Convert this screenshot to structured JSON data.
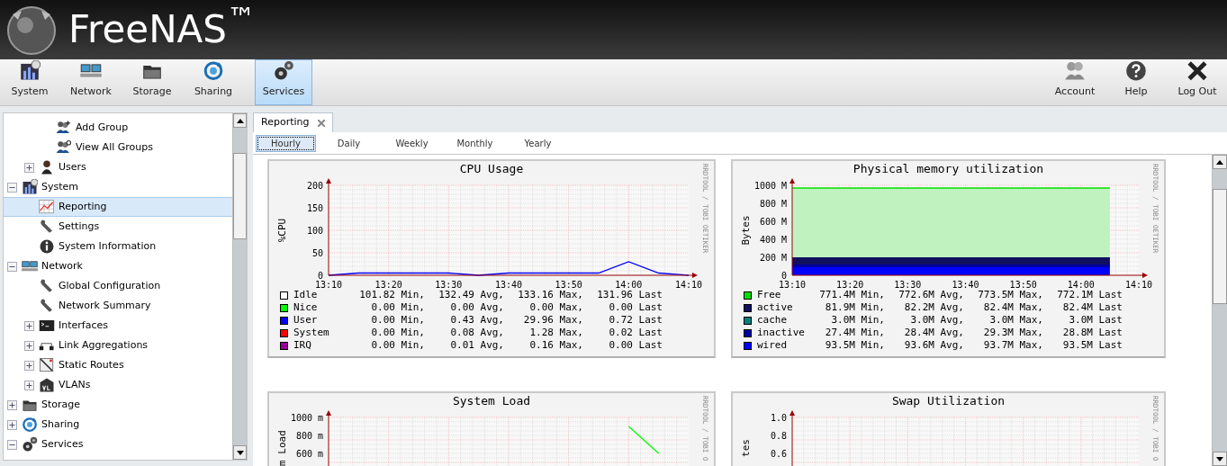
{
  "header": {
    "logo": "FreeNAS$^{™}$"
  },
  "toolbar": {
    "left": [
      {
        "label": "System",
        "kind": "system",
        "selected": false
      },
      {
        "label": "Network",
        "kind": "network",
        "selected": false
      },
      {
        "label": "Storage",
        "kind": "storage",
        "selected": false
      },
      {
        "label": "Sharing",
        "kind": "sharing",
        "selected": false
      },
      {
        "label": "Services",
        "kind": "services",
        "selected": true
      }
    ],
    "right": [
      {
        "label": "Account",
        "kind": "account"
      },
      {
        "label": "Help",
        "kind": "help"
      },
      {
        "label": "Log Out",
        "kind": "logout"
      }
    ]
  },
  "tree": [
    {
      "children": [
        {
          "children": [
            {
              "label": "Add Group",
              "kind": "groupadd",
              "selected": false
            },
            {
              "label": "View All Groups",
              "kind": "groups",
              "selected": false
            }
          ]
        },
        {
          "label": "Users",
          "kind": "user",
          "expanded": false,
          "selected": false
        }
      ]
    },
    {
      "label": "System",
      "kind": "system",
      "expanded": true,
      "selected": false,
      "children": [
        {
          "label": "Reporting",
          "kind": "chart",
          "selected": true
        },
        {
          "label": "Settings",
          "kind": "wrench",
          "selected": false
        },
        {
          "label": "System Information",
          "kind": "info",
          "selected": false
        }
      ]
    },
    {
      "label": "Network",
      "kind": "network",
      "expanded": true,
      "selected": false,
      "children": [
        {
          "label": "Global Configuration",
          "kind": "wrench",
          "selected": false
        },
        {
          "label": "Network Summary",
          "kind": "wrench",
          "selected": false
        },
        {
          "label": "Interfaces",
          "kind": "terminal",
          "expanded": false,
          "selected": false
        },
        {
          "label": "Link Aggregations",
          "kind": "link",
          "expanded": false,
          "selected": false
        },
        {
          "label": "Static Routes",
          "kind": "route",
          "expanded": false,
          "selected": false
        },
        {
          "label": "VLANs",
          "kind": "vlan",
          "expanded": false,
          "selected": false
        }
      ]
    },
    {
      "label": "Storage",
      "kind": "storage",
      "expanded": false,
      "selected": false
    },
    {
      "label": "Sharing",
      "kind": "sharing",
      "expanded": false,
      "selected": false
    },
    {
      "label": "Services",
      "kind": "services",
      "expanded": true,
      "selected": false
    }
  ],
  "tab": {
    "label": "Reporting"
  },
  "periods": [
    {
      "label": "Hourly",
      "selected": true
    },
    {
      "label": "Daily",
      "selected": false
    },
    {
      "label": "Weekly",
      "selected": false
    },
    {
      "label": "Monthly",
      "selected": false
    },
    {
      "label": "Yearly",
      "selected": false
    }
  ],
  "charts": [
    {
      "credit": "RRDTOOL / TOBI OETIKER",
      "chart_data": {
        "type": "line",
        "grid": true,
        "title": "CPU Usage",
        "ylabel": "%CPU",
        "categories": [
          "13:10",
          null,
          "13:20",
          null,
          "13:30",
          null,
          "13:40",
          null,
          "13:50",
          null,
          "14:00",
          null,
          "14:10"
        ],
        "ylim": [
          0,
          200
        ],
        "yticks": [
          0,
          50,
          100,
          150,
          200
        ],
        "series": [
          {
            "name": "Idle",
            "color": "#ffffff",
            "values": [
              null,
              null,
              null,
              null,
              null,
              null,
              null,
              null,
              null,
              null,
              null,
              null,
              null
            ]
          },
          {
            "name": "Nice",
            "color": "#00ff00",
            "values": [
              null,
              null,
              null,
              null,
              null,
              null,
              null,
              null,
              null,
              null,
              null,
              null,
              null
            ]
          },
          {
            "name": "User",
            "color": "#0000ff",
            "values": [
              0,
              5,
              5,
              5,
              5,
              0,
              5,
              5,
              5,
              5,
              30,
              5,
              0
            ]
          },
          {
            "name": "System",
            "color": "#ff0000",
            "values": [
              null,
              null,
              null,
              null,
              null,
              null,
              null,
              null,
              null,
              null,
              null,
              null,
              null
            ]
          },
          {
            "name": "IRQ",
            "color": "#990099",
            "values": [
              null,
              null,
              null,
              null,
              null,
              null,
              null,
              null,
              null,
              null,
              null,
              null,
              null
            ]
          }
        ]
      },
      "legend": [
        {
          "stats": [
            "101.82 Min,",
            "132.49 Avg,",
            "133.16 Max,",
            "131.96 Last"
          ]
        },
        {
          "stats": [
            "0.00 Min,",
            "0.00 Avg,",
            "0.00 Max,",
            "0.00 Last"
          ]
        },
        {
          "stats": [
            "0.00 Min,",
            "0.43 Avg,",
            "29.96 Max,",
            "0.72 Last"
          ]
        },
        {
          "stats": [
            "0.00 Min,",
            "0.08 Avg,",
            "1.28 Max,",
            "0.02 Last"
          ]
        },
        {
          "stats": [
            "0.00 Min,",
            "0.01 Avg,",
            "0.16 Max,",
            "0.00 Last"
          ]
        }
      ]
    },
    {
      "credit": "RRDTOOL / TOBI OETIKER",
      "chart_data": {
        "type": "area",
        "grid": true,
        "stacked": true,
        "title": "Physical memory utilization",
        "ylabel": "Bytes",
        "categories": [
          "13:10",
          null,
          "13:20",
          null,
          "13:30",
          null,
          "13:40",
          null,
          "13:50",
          null,
          "14:00",
          null,
          "14:10"
        ],
        "ylim": [
          0,
          1000
        ],
        "yticks": [
          {
            "value": 0,
            "label": "0"
          },
          {
            "value": 200,
            "label": "200 M"
          },
          {
            "value": 400,
            "label": "400 M"
          },
          {
            "value": 600,
            "label": "600 M"
          },
          {
            "value": 800,
            "label": "800 M"
          },
          {
            "value": 1000,
            "label": "1000 M"
          }
        ],
        "series": [
          {
            "name": "Free",
            "color": "#00e000",
            "values": [
              770,
              770,
              770,
              770,
              770,
              770,
              770,
              770,
              770,
              770,
              770,
              770,
              null
            ]
          },
          {
            "name": "active",
            "color": "#101060",
            "values": [
              80,
              80,
              80,
              80,
              80,
              80,
              80,
              80,
              80,
              80,
              80,
              80,
              null
            ]
          },
          {
            "name": "cache",
            "color": "#008080",
            "values": [
              null,
              null,
              null,
              null,
              null,
              null,
              null,
              null,
              null,
              null,
              null,
              null,
              null
            ]
          },
          {
            "name": "inactive",
            "color": "#0000a0",
            "values": [
              30,
              30,
              30,
              30,
              30,
              30,
              30,
              30,
              30,
              30,
              30,
              30,
              null
            ]
          },
          {
            "name": "wired",
            "color": "#0000ff",
            "values": [
              90,
              90,
              90,
              90,
              90,
              90,
              90,
              90,
              90,
              90,
              90,
              90,
              null
            ]
          }
        ]
      },
      "legend": [
        {
          "stats": [
            "771.4M Min,",
            "772.6M Avg,",
            "773.5M Max,",
            "772.1M Last"
          ]
        },
        {
          "stats": [
            "81.9M Min,",
            "82.2M Avg,",
            "82.4M Max,",
            "82.4M Last"
          ]
        },
        {
          "stats": [
            "3.0M Min,",
            "3.0M Avg,",
            "3.0M Max,",
            "3.0M Last"
          ]
        },
        {
          "stats": [
            "27.4M Min,",
            "28.4M Avg,",
            "29.3M Max,",
            "28.8M Last"
          ]
        },
        {
          "stats": [
            "93.5M Min,",
            "93.6M Avg,",
            "93.7M Max,",
            "93.5M Last"
          ]
        }
      ]
    },
    {
      "credit": "RRDTOOL / TOBI O",
      "chart_data": {
        "type": "line",
        "grid": true,
        "title": "System Load",
        "ylabel": "m Load",
        "categories": [
          null,
          null,
          null,
          null,
          null,
          null,
          null,
          null,
          null,
          null,
          null,
          null,
          null
        ],
        "ylim": [
          0,
          1000
        ],
        "yticks": [
          {
            "value": 600,
            "label": "600 m"
          },
          {
            "value": 800,
            "label": "800 m"
          },
          {
            "value": 1000,
            "label": "1000 m"
          }
        ],
        "series": [
          {
            "color": "#00ff00",
            "values": [
              null,
              null,
              null,
              null,
              null,
              null,
              null,
              null,
              null,
              null,
              900,
              600,
              null
            ]
          }
        ]
      }
    },
    {
      "credit": "RRDTOOL / TOBI O",
      "chart_data": {
        "type": "line",
        "grid": true,
        "title": "Swap Utilization",
        "ylabel": "tes",
        "categories": [
          null,
          null,
          null,
          null,
          null,
          null,
          null,
          null,
          null,
          null,
          null,
          null,
          null
        ],
        "ylim": [
          0,
          1
        ],
        "yticks": [
          {
            "value": 0.6,
            "label": "0.6"
          },
          {
            "value": 0.8,
            "label": "0.8"
          },
          {
            "value": 1,
            "label": "1.0"
          }
        ]
      }
    }
  ]
}
